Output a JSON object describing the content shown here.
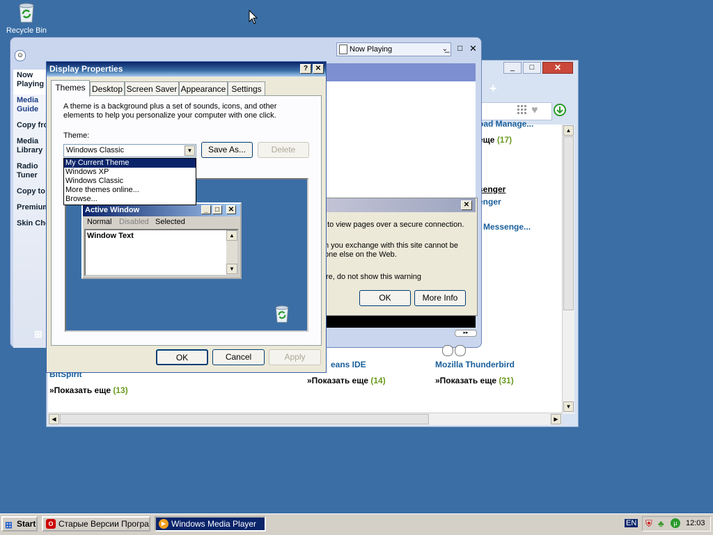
{
  "desktop": {
    "recycle_bin_label": "Recycle Bin"
  },
  "browser": {
    "col1": {
      "more_label": "»Показать еще",
      "more_count": "(13)",
      "link": "BitSpirit"
    },
    "col2": {
      "link_partial": "eans IDE",
      "more_label": "»Показать еще",
      "more_count": "(14)"
    },
    "col3": {
      "link_top_partial": "oad Manage...",
      "more1_count": "(17)",
      "link_messenger1": "senger",
      "link_messenger2": "enger",
      "link_messenger3": "Messenge...",
      "link_thunderbird": "Mozilla Thunderbird",
      "more_label": "»Показать еще",
      "more_count": "(31)"
    },
    "plus_tab": "+"
  },
  "wmp": {
    "selector": "Now Playing",
    "sidebar": [
      {
        "label": "Now Playing"
      },
      {
        "label": "Media Guide"
      },
      {
        "label": "Copy from CD"
      },
      {
        "label": "Media Library"
      },
      {
        "label": "Radio Tuner"
      },
      {
        "label": "Copy to CD or Device"
      },
      {
        "label": "Premium Services"
      },
      {
        "label": "Skin Chooser"
      }
    ]
  },
  "security_dialog": {
    "line1": "t to view pages over a secure connection.",
    "line2": "n you exchange with this site cannot be",
    "line3": "one else on the Web.",
    "line4": "re, do not show this warning",
    "ok": "OK",
    "more_info": "More Info"
  },
  "display": {
    "title": "Display Properties",
    "tabs": [
      "Themes",
      "Desktop",
      "Screen Saver",
      "Appearance",
      "Settings"
    ],
    "description": "A theme is a background plus a set of sounds, icons, and other elements to help you personalize your computer with one click.",
    "theme_label": "Theme:",
    "theme_value": "Windows Classic",
    "options": [
      "My Current Theme",
      "Windows XP",
      "Windows Classic",
      "More themes online...",
      "Browse..."
    ],
    "save_as": "Save As...",
    "delete": "Delete",
    "preview": {
      "active_window": "Active Window",
      "menu": [
        "Normal",
        "Disabled",
        "Selected"
      ],
      "window_text": "Window Text"
    },
    "ok": "OK",
    "cancel": "Cancel",
    "apply": "Apply"
  },
  "taskbar": {
    "start": "Start",
    "task1": "Старые Версии Програ...",
    "task2": "Windows Media Player",
    "lang": "EN",
    "clock": "12:03"
  },
  "colors": {
    "desktop": "#3a6ea5",
    "title_blue": "#0a246a",
    "link": "#185e9b",
    "count_green": "#6a9a1f"
  }
}
